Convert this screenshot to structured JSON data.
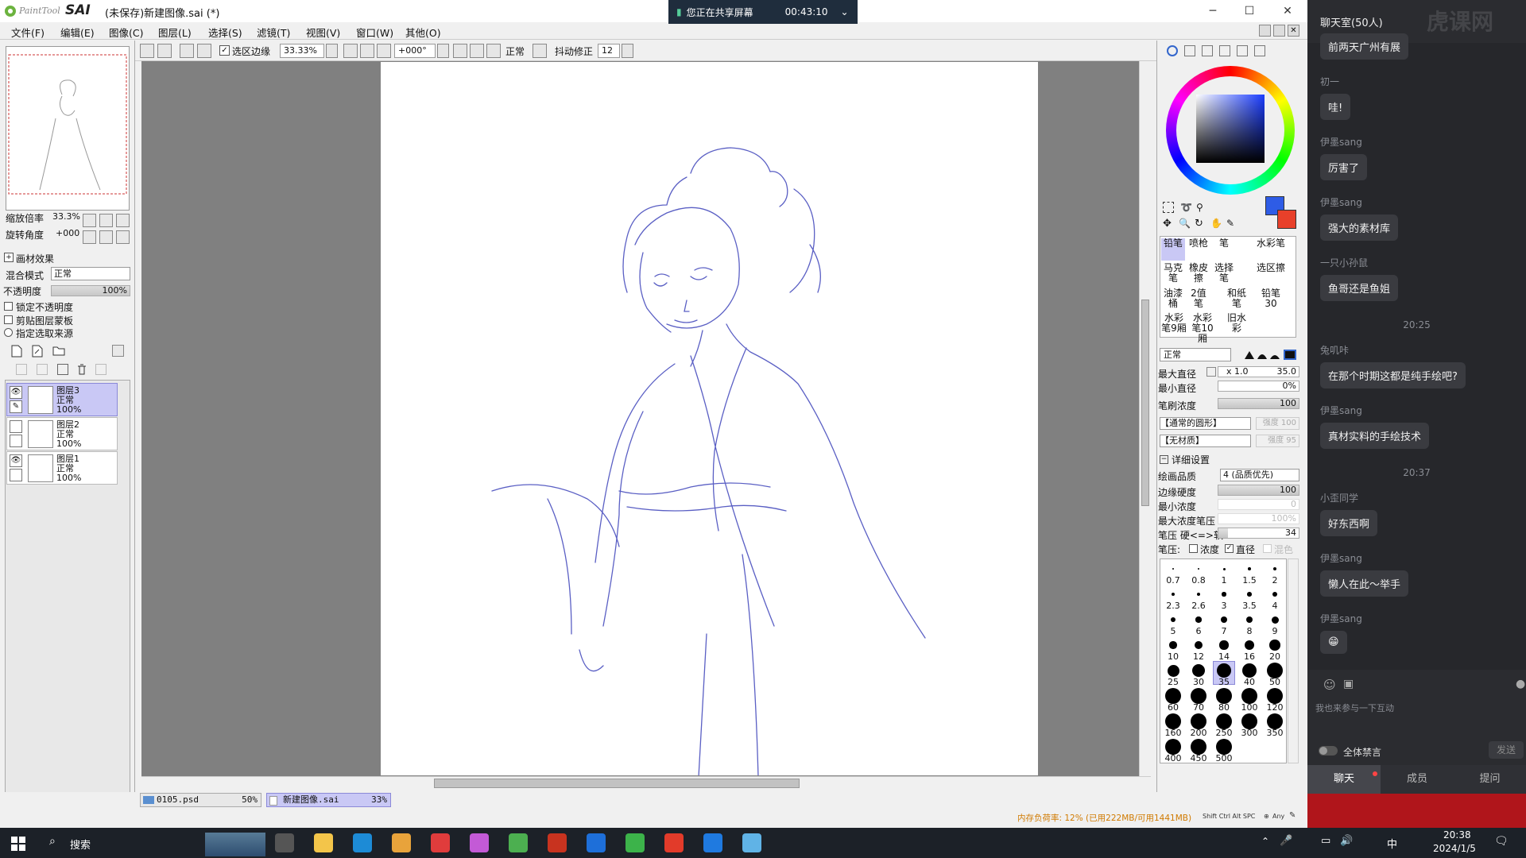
{
  "window": {
    "title": "(未保存)新建图像.sai (*)",
    "logo_paint": "PaintTool",
    "logo_sai": "SAI",
    "min_icon": "minimize-icon",
    "max_icon": "maximize-icon",
    "close_icon": "close-icon"
  },
  "share_banner": {
    "text": "您正在共享屏幕",
    "time": "00:43:10"
  },
  "menu": [
    "文件(F)",
    "编辑(E)",
    "图像(C)",
    "图层(L)",
    "选择(S)",
    "滤镜(T)",
    "视图(V)",
    "窗口(W)",
    "其他(O)"
  ],
  "toolbar": {
    "selection_edge_label": "选区边缘",
    "selection_edge_checked": true,
    "zoom": "33.33%",
    "angle": "+000°",
    "blend": "正常",
    "stabilizer_label": "抖动修正",
    "stabilizer_value": "12"
  },
  "left": {
    "zoom_label": "缩放倍率",
    "zoom_value": "33.3%",
    "rotate_label": "旋转角度",
    "rotate_value": "+000",
    "paper_effect": "画材效果",
    "blend_label": "混合模式",
    "blend_value": "正常",
    "opacity_label": "不透明度",
    "opacity_value": "100%",
    "lock_opacity": "锁定不透明度",
    "clip_mask": "剪贴图层蒙板",
    "selection_source": "指定选取来源",
    "layers": [
      {
        "name": "图层3",
        "mode": "正常",
        "opacity": "100%",
        "selected": true
      },
      {
        "name": "图层2",
        "mode": "正常",
        "opacity": "100%",
        "selected": false
      },
      {
        "name": "图层1",
        "mode": "正常",
        "opacity": "100%",
        "selected": false
      }
    ]
  },
  "right": {
    "tools": [
      "铅笔",
      "喷枪",
      "笔",
      "水彩笔",
      "马克笔",
      "橡皮擦",
      "选择笔",
      "选区擦",
      "油漆桶",
      "2值笔",
      "和纸笔",
      "铅笔30",
      "水彩笔9厢",
      "水彩笔10厢",
      "旧水彩"
    ],
    "brush_mode": "正常",
    "max_diameter_label": "最大直径",
    "max_diameter_mult": "x 1.0",
    "max_diameter_value": "35.0",
    "min_diameter_label": "最小直径",
    "min_diameter_value": "0%",
    "density_label": "笔刷浓度",
    "density_value": "100",
    "shape_value": "【通常的圆形】",
    "shape_strength": "强度 100",
    "texture_value": "【无材质】",
    "texture_strength": "强度 95",
    "detail_label": "详细设置",
    "quality_label": "绘画品质",
    "quality_value": "4 (品质优先)",
    "edge_hardness_label": "边缘硬度",
    "edge_hardness_value": "100",
    "min_density_label": "最小浓度",
    "min_density_value": "0",
    "max_density_pressure_label": "最大浓度笔压",
    "max_density_pressure_value": "100%",
    "pressure_label": "笔压 硬<=>软",
    "pressure_value": "34",
    "pressure_opts_label": "笔压:",
    "opt_density": "浓度",
    "opt_diameter": "直径",
    "opt_blend": "混色",
    "sizes": [
      [
        "0.7",
        "0.8",
        "1",
        "1.5",
        "2"
      ],
      [
        "2.3",
        "2.6",
        "3",
        "3.5",
        "4"
      ],
      [
        "5",
        "6",
        "7",
        "8",
        "9"
      ],
      [
        "10",
        "12",
        "14",
        "16",
        "20"
      ],
      [
        "25",
        "30",
        "35",
        "40",
        "50"
      ],
      [
        "60",
        "70",
        "80",
        "100",
        "120"
      ],
      [
        "160",
        "200",
        "250",
        "300",
        "350"
      ],
      [
        "400",
        "450",
        "500"
      ]
    ],
    "selected_size": "35",
    "primary_color": "#2e5ce6",
    "secondary_color": "#e8402a"
  },
  "status": {
    "tabs": [
      {
        "name": "0105.psd",
        "zoom": "50%"
      },
      {
        "name": "新建图像.sai",
        "zoom": "33%"
      }
    ],
    "memory": "内存负荷率: 12% (已用222MB/可用1441MB)",
    "keys": "Shift Ctrl Alt SPC",
    "any_label": "Any"
  },
  "chat": {
    "header": "聊天室(50人)",
    "watermark": "虎课网",
    "messages": [
      {
        "type": "msg",
        "text": "前两天广州有展"
      },
      {
        "type": "name",
        "text": "初一"
      },
      {
        "type": "msg",
        "text": "哇!"
      },
      {
        "type": "name",
        "text": "伊墨sang"
      },
      {
        "type": "msg",
        "text": "厉害了"
      },
      {
        "type": "name",
        "text": "伊墨sang"
      },
      {
        "type": "msg",
        "text": "强大的素材库"
      },
      {
        "type": "name",
        "text": "一只小孙鼠"
      },
      {
        "type": "msg",
        "text": "鱼哥还是鱼姐"
      },
      {
        "type": "time",
        "text": "20:25"
      },
      {
        "type": "name",
        "text": "兔叽咔"
      },
      {
        "type": "msg",
        "text": "在那个时期这都是纯手绘吧?"
      },
      {
        "type": "name",
        "text": "伊墨sang"
      },
      {
        "type": "msg",
        "text": "真材实料的手绘技术"
      },
      {
        "type": "time",
        "text": "20:37"
      },
      {
        "type": "name",
        "text": "小歪同学"
      },
      {
        "type": "msg",
        "text": "好东西啊"
      },
      {
        "type": "name",
        "text": "伊墨sang"
      },
      {
        "type": "msg",
        "text": "懒人在此～举手"
      },
      {
        "type": "name",
        "text": "伊墨sang"
      },
      {
        "type": "msg",
        "text": "😁"
      }
    ],
    "input_placeholder": "我也来参与一下互动",
    "mute_all": "全体禁言",
    "send": "发送",
    "tabs": [
      "聊天",
      "成员",
      "提问"
    ]
  },
  "taskbar": {
    "search": "搜索",
    "time": "20:38",
    "date": "2024/1/5",
    "ime": "中",
    "icons": [
      "task-view-icon",
      "file-explorer-icon",
      "edge-icon",
      "chrome-icon",
      "netease-music-icon",
      "color-app-icon",
      "sai-icon",
      "illustrator-icon",
      "photoshop-icon",
      "wechat-icon",
      "wps-icon",
      "p-app-icon",
      "notepad-icon"
    ]
  }
}
